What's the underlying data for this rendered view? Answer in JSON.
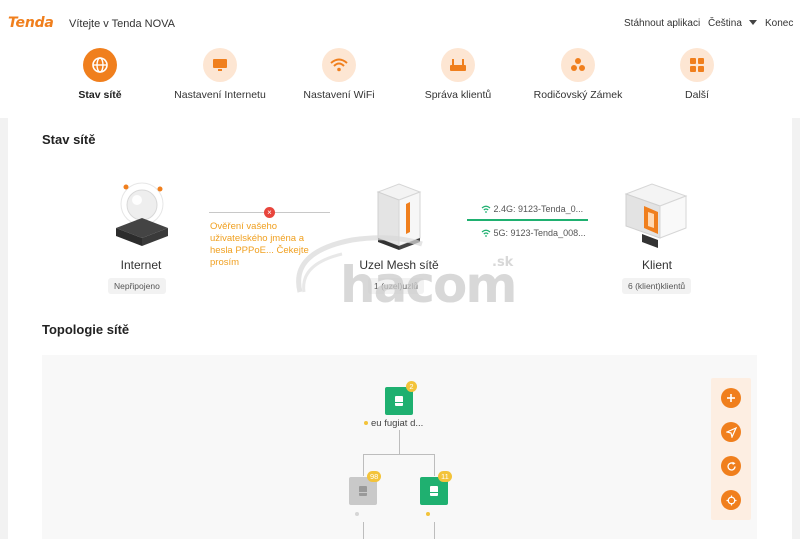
{
  "header": {
    "logo": "Tenda",
    "welcome": "Vítejte v Tenda NOVA",
    "download_app": "Stáhnout aplikaci",
    "language": "Čeština",
    "logout": "Konec"
  },
  "nav": [
    {
      "label": "Stav sítě",
      "icon": "globe-icon",
      "active": true
    },
    {
      "label": "Nastavení Internetu",
      "icon": "monitor-icon",
      "active": false
    },
    {
      "label": "Nastavení WiFi",
      "icon": "wifi-icon",
      "active": false
    },
    {
      "label": "Správa klientů",
      "icon": "router-icon",
      "active": false
    },
    {
      "label": "Rodičovský Zámek",
      "icon": "family-icon",
      "active": false
    },
    {
      "label": "Další",
      "icon": "grid-icon",
      "active": false
    }
  ],
  "status": {
    "title": "Stav sítě",
    "internet": {
      "name": "Internet",
      "state": "Nepřipojeno"
    },
    "warning": "Ověření vašeho uživatelského jména a hesla PPPoE... Čekejte prosím",
    "mesh": {
      "name": "Uzel Mesh sítě",
      "count": "1 (uzel)uzlů"
    },
    "wifi_24": "2.4G: 9123-Tenda_0...",
    "wifi_5": "5G: 9123-Tenda_008...",
    "client": {
      "name": "Klient",
      "count": "6 (klient)klientů"
    }
  },
  "topology": {
    "title": "Topologie sítě",
    "root": {
      "label": "eu fugiat d...",
      "badge": "2"
    },
    "children": [
      {
        "badge": "98",
        "online": false
      },
      {
        "badge": "11",
        "online": true
      }
    ],
    "tools": [
      "add-icon",
      "send-icon",
      "refresh-icon",
      "locate-icon"
    ]
  },
  "colors": {
    "accent": "#f07f1d",
    "accent_light": "#fde6d3",
    "mesh_green": "#1fb070",
    "warning": "#f0a020",
    "error_red": "#e8453c"
  },
  "watermark": {
    "text": "hacom",
    "suffix": ".sk"
  }
}
